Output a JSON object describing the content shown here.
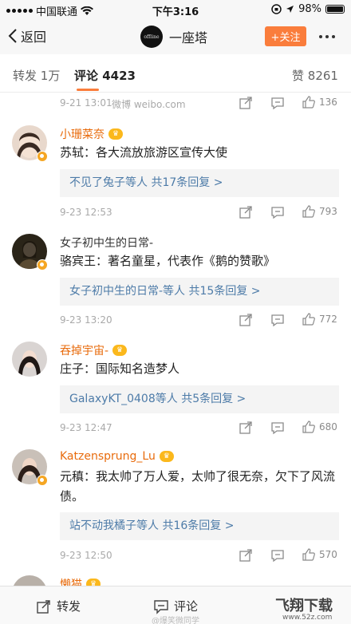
{
  "status_bar": {
    "carrier": "中国联通",
    "time": "下午3:16",
    "battery": "98%",
    "battery_level": 0.98
  },
  "nav": {
    "back_label": "返回",
    "avatar_text": "offline",
    "title": "一座塔",
    "follow_label": "+关注"
  },
  "tabs": {
    "repost_label": "转发",
    "repost_count": "1万",
    "comment_label": "评论",
    "comment_count": "4423",
    "like_label": "赞",
    "like_count": "8261"
  },
  "top_meta": {
    "date": "9-21 13:01",
    "source": "微博 weibo.com",
    "likes": "136"
  },
  "comments": [
    {
      "name": "小珊菜奈",
      "text": "苏轼：各大流放旅游区宣传大使",
      "reply_users": "不见了兔子等人",
      "reply_count": "共17条回复 >",
      "date": "9-23 12:53",
      "likes": "793"
    },
    {
      "name": "女子初中生的日常-",
      "text": "骆宾王：著名童星，代表作《鹅的赞歌》",
      "reply_users": "女子初中生的日常-等人",
      "reply_count": "共15条回复 >",
      "date": "9-23 13:20",
      "likes": "772"
    },
    {
      "name": "吞掉宇宙-",
      "text": "庄子：国际知名造梦人",
      "reply_users": "GalaxyKT_0408等人",
      "reply_count": "共5条回复 >",
      "date": "9-23 12:47",
      "likes": "680"
    },
    {
      "name": "Katzensprung_Lu",
      "text": "元稹：我太帅了万人爱，太帅了很无奈，欠下了风流债。",
      "reply_users": "站不动我橘子等人",
      "reply_count": "共16条回复 >",
      "date": "9-23 12:50",
      "likes": "570"
    },
    {
      "name": "懒猫"
    }
  ],
  "bottom_bar": {
    "repost_label": "转发",
    "comment_label": "评论",
    "watermark": "@爆笑微同学",
    "logo": "飞翔下载",
    "logo_url": "www.52z.com"
  },
  "colors": {
    "accent": "#fa7d3c",
    "link": "#4d7ba8",
    "vip_name": "#e86b0c"
  }
}
